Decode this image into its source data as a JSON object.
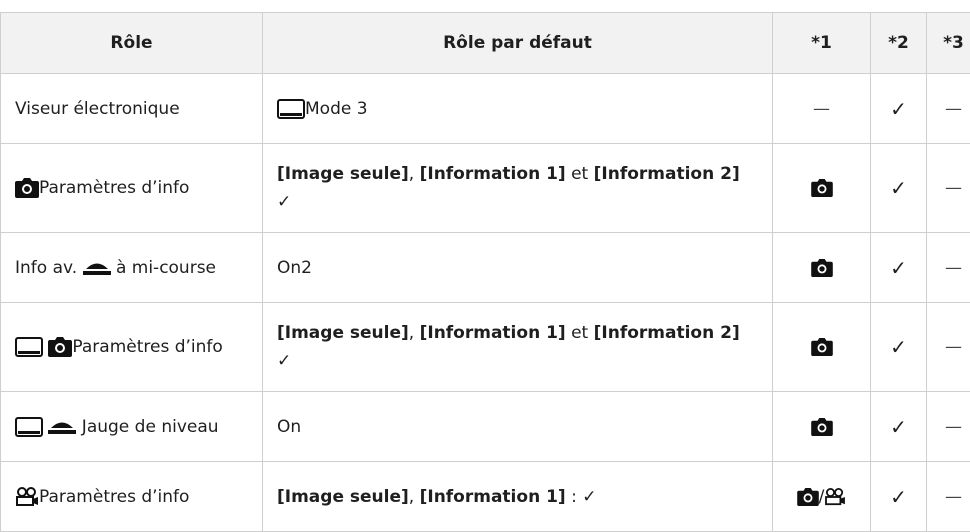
{
  "header": {
    "role": "Rôle",
    "default_role": "Rôle par défaut",
    "col1": "*1",
    "col2": "*2",
    "col3": "*3"
  },
  "rows": [
    {
      "role": "Viseur électronique",
      "default": {
        "text": "Mode 3"
      },
      "c1": "—",
      "c2": "✓",
      "c3": "—",
      "role_icons": [],
      "default_icons": [
        "lcd-monitor-icon"
      ]
    },
    {
      "role": "Paramètres d’info",
      "role_icons": [
        "camera-icon"
      ],
      "default": {
        "p1": "[Image seule]",
        "p2": ", ",
        "p3": "[Information 1]",
        "p4": " et ",
        "p5": "[Information 2]",
        "p6": " ✓"
      },
      "c1_icons": [
        "camera-icon"
      ],
      "c2": "✓",
      "c3": "—"
    },
    {
      "role": "Info av. ",
      "role_suffix": " à mi-course",
      "role_icons": [
        "shutter-button-icon"
      ],
      "default": {
        "text": "On2"
      },
      "c1_icons": [
        "camera-icon"
      ],
      "c2": "✓",
      "c3": "—"
    },
    {
      "role": "Paramètres d’info",
      "role_icons": [
        "lcd-monitor-icon",
        "camera-icon"
      ],
      "default": {
        "p1": "[Image seule]",
        "p2": ", ",
        "p3": "[Information 1]",
        "p4": " et ",
        "p5": "[Information 2]",
        "p6": " ✓"
      },
      "c1_icons": [
        "camera-icon"
      ],
      "c2": "✓",
      "c3": "—"
    },
    {
      "role": " Jauge de niveau",
      "role_icons": [
        "lcd-monitor-icon",
        "shutter-button-icon"
      ],
      "default": {
        "text": "On"
      },
      "c1_icons": [
        "camera-icon"
      ],
      "c2": "✓",
      "c3": "—"
    },
    {
      "role": "Paramètres d’info",
      "role_icons": [
        "movie-camera-icon"
      ],
      "default": {
        "p1": "[Image seule]",
        "p2": ", ",
        "p3": "[Information 1]",
        "p4": " : ✓"
      },
      "c1_icons": [
        "camera-icon",
        "movie-camera-icon"
      ],
      "c1_separator": "/",
      "c2": "✓",
      "c3": "—"
    }
  ]
}
